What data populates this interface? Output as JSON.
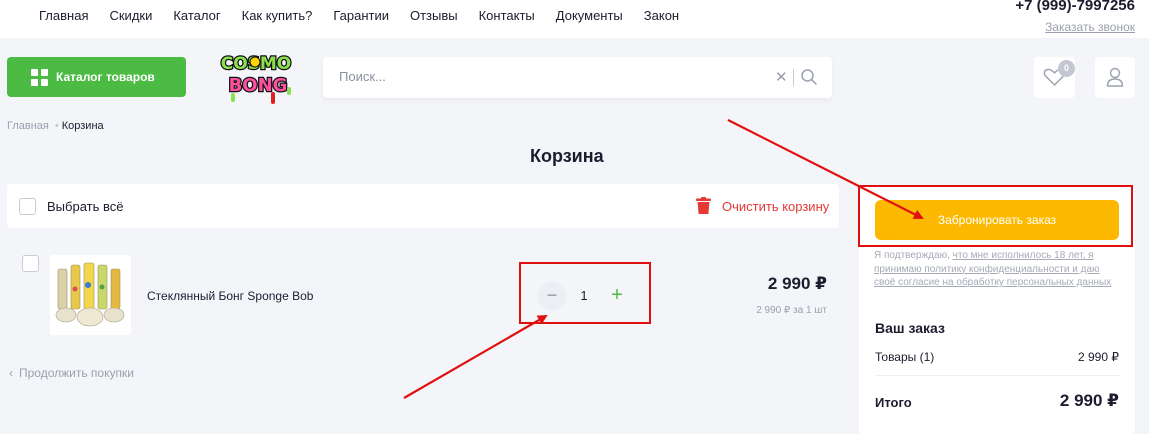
{
  "header": {
    "nav": [
      "Главная",
      "Скидки",
      "Каталог",
      "Как купить?",
      "Гарантии",
      "Отзывы",
      "Контакты",
      "Документы",
      "Закон"
    ],
    "phone": "+7 (999)-7997256",
    "callback": "Заказать звонок",
    "catalog_button": "Каталог товаров",
    "logo_text": [
      "COSMO",
      "BONG"
    ],
    "search_placeholder": "Поиск...",
    "favorites_count": "0"
  },
  "breadcrumb": {
    "home": "Главная",
    "current": "Корзина"
  },
  "page_title": "Корзина",
  "cart": {
    "select_all": "Выбрать всё",
    "clear": "Очистить корзину",
    "items": [
      {
        "name": "Стеклянный Бонг Sponge Bob",
        "quantity": "1",
        "price": "2 990 ₽",
        "unit_price": "2 990 ₽ за 1 шт"
      }
    ],
    "continue": "Продолжить покупки"
  },
  "order": {
    "book_button": "Забронировать заказ",
    "consent_prefix": "Я подтверждаю, ",
    "consent_age_link": "что мне исполнилось 18 лет, я принимаю политику конфиденциальности и даю своё согласие на обработку персональных данных",
    "title": "Ваш заказ",
    "goods_label": "Товары (1)",
    "goods_value": "2 990 ₽",
    "total_label": "Итого",
    "total_value": "2 990 ₽"
  },
  "colors": {
    "accent_green": "#4cbb44",
    "book_yellow": "#fcb900",
    "danger_red": "#e53935",
    "annotation_red": "#e01010"
  }
}
